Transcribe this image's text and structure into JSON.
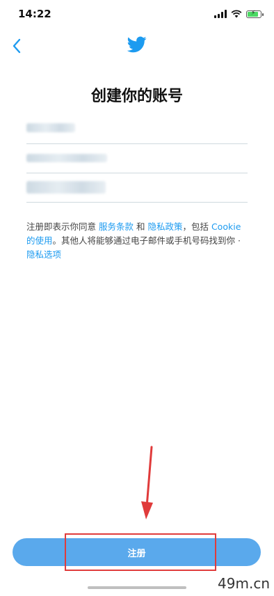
{
  "status_bar": {
    "time": "14:22"
  },
  "nav": {
    "back_icon": "chevron-left-icon",
    "logo_icon": "twitter-bird-icon"
  },
  "page": {
    "title": "创建你的账号"
  },
  "terms": {
    "part1": "注册即表示你同意 ",
    "tos_link": "服务条款",
    "part2": " 和 ",
    "privacy_link": "隐私政策",
    "part3": "，包括 ",
    "cookie_link": "Cookie 的使用",
    "part4": "。其他人将能够通过电子邮件或手机号码找到你 · ",
    "privacy_options_link": "隐私选项"
  },
  "signup_button": {
    "label": "注册"
  },
  "watermark": "49m.cn",
  "colors": {
    "accent": "#1d9bf0",
    "button": "#5aa9ec",
    "annotation": "#e03b3b"
  }
}
